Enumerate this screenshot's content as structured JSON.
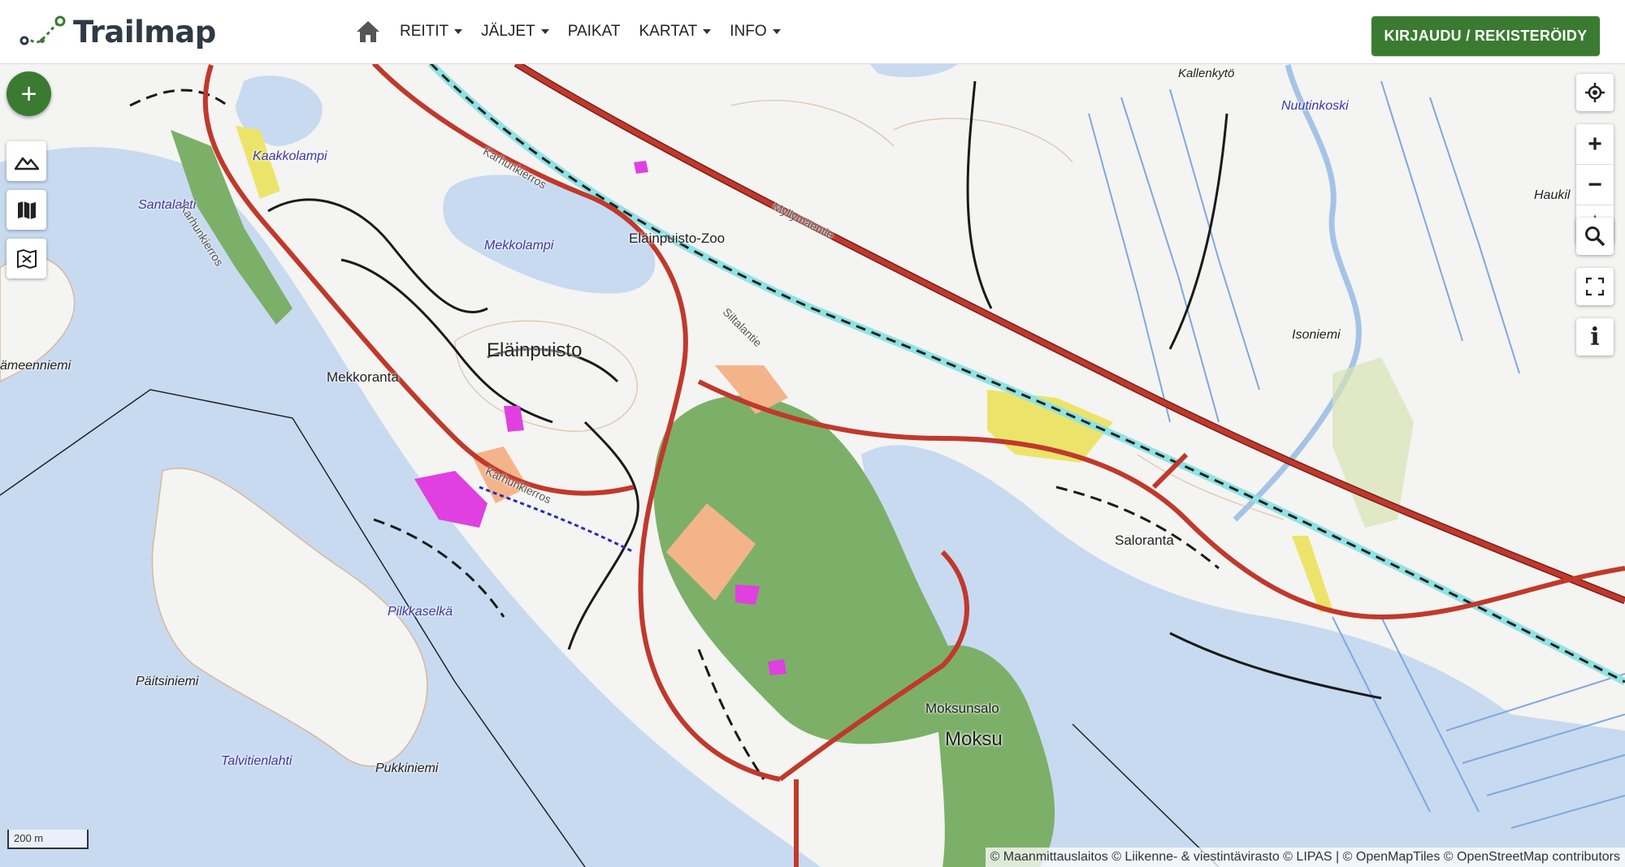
{
  "app": {
    "logo_text": "Trailmap",
    "brand_color": "#3a7b31"
  },
  "nav": {
    "home_icon": "home-icon",
    "items": [
      {
        "label": "REITIT",
        "has_dropdown": true
      },
      {
        "label": "JÄLJET",
        "has_dropdown": true
      },
      {
        "label": "PAIKAT",
        "has_dropdown": false
      },
      {
        "label": "KARTAT",
        "has_dropdown": true
      },
      {
        "label": "INFO",
        "has_dropdown": true
      }
    ]
  },
  "header": {
    "login_label": "KIRJAUDU / REKISTERÖIDY"
  },
  "map_controls": {
    "add_label": "+",
    "layers": [
      "terrain-icon",
      "map-icon",
      "map-off-icon"
    ],
    "right": {
      "locate": "locate-icon",
      "zoom_in": "+",
      "zoom_out": "−",
      "compass": "compass-icon",
      "search": "search-icon",
      "fullscreen": "fullscreen-icon",
      "info": "i"
    }
  },
  "map": {
    "labels": {
      "kaakkolampi": "Kaakkolampi",
      "santalahti": "Santalahti",
      "hameenniemi": "ämeenniemi",
      "mekkoranta": "Mekkoranta",
      "karhunkierros1": "Karhunkierros",
      "karhunkierros2": "Karhunkierros",
      "karhunkierros3": "Karhunkierros",
      "mekkolampi": "Mekkolampi",
      "elainpuisto": "Eläinpuisto",
      "elainpuisto_zoo": "Eläinpuisto-Zoo",
      "myllymaentie": "Myllymäentie",
      "siltalantie": "Siltalantie",
      "pilkkaselka": "Pilkkaselkä",
      "paitsiniemi": "Päitsiniemi",
      "talvitienlahti": "Talvitienlahti",
      "pukkiniemi": "Pukkiniemi",
      "moksunsalo": "Moksunsalo",
      "moksu": "Moksu",
      "saloranta": "Saloranta",
      "kallenkyto": "Kallenkytö",
      "nuutinkoski": "Nuutinkoski",
      "isoniemi": "Isoniemi",
      "haukila": "Haukil"
    },
    "scale_label": "200 m",
    "attribution": "© Maanmittauslaitos © Liikenne- & viestintävirasto © LIPAS | © OpenMapTiles © OpenStreetMap contributors",
    "colors": {
      "water": "#c8daf0",
      "land": "#f4f4f2",
      "road": "#c0392b",
      "forest": "#7cb069",
      "residential": "#f3b48a",
      "field": "#ece46a",
      "building": "#e040e0"
    }
  }
}
